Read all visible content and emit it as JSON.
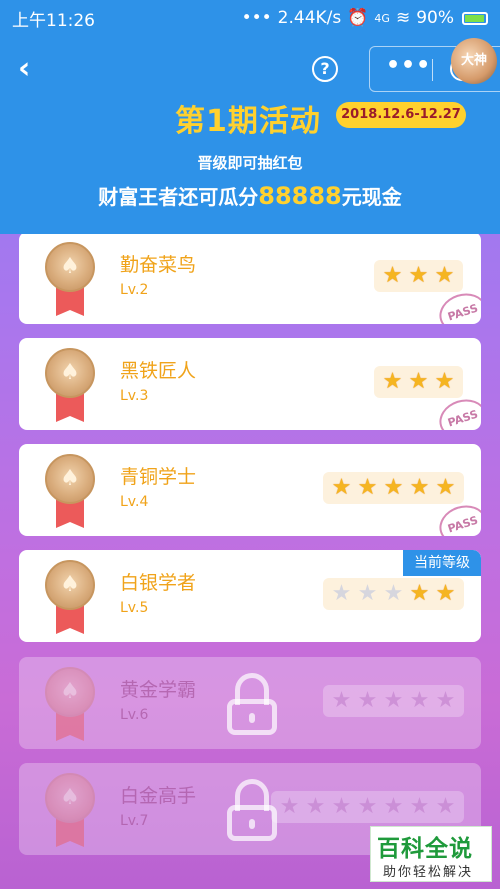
{
  "status_bar": {
    "time": "上午11:26",
    "network_speed": "2.44K/s",
    "signal": "4G",
    "battery": "90%"
  },
  "header": {
    "back_icon": "chevron-left-icon",
    "title": "第1期活动",
    "date_range": "2018.12.6-12.27",
    "subtitle": "晋级即可抽红包",
    "prize_prefix": "财富王者还可瓜分",
    "prize_amount": "88888",
    "prize_suffix": "元现金",
    "avatar_text": "大神"
  },
  "levels": [
    {
      "name": "勤奋菜鸟",
      "level": "Lv.2",
      "stars_total": 3,
      "stars_lit": 3,
      "passed": true,
      "pass_text": "PASS",
      "current": false,
      "locked": false
    },
    {
      "name": "黑铁匠人",
      "level": "Lv.3",
      "stars_total": 3,
      "stars_lit": 3,
      "passed": true,
      "pass_text": "PASS",
      "current": false,
      "locked": false
    },
    {
      "name": "青铜学士",
      "level": "Lv.4",
      "stars_total": 5,
      "stars_lit": 5,
      "passed": true,
      "pass_text": "PASS",
      "current": false,
      "locked": false
    },
    {
      "name": "白银学者",
      "level": "Lv.5",
      "stars_total": 5,
      "stars_lit": 2,
      "passed": false,
      "current": true,
      "current_label": "当前等级",
      "locked": false
    },
    {
      "name": "黄金学霸",
      "level": "Lv.6",
      "stars_total": 5,
      "stars_lit": 0,
      "passed": false,
      "current": false,
      "locked": true
    },
    {
      "name": "白金高手",
      "level": "Lv.7",
      "stars_total": 7,
      "stars_lit": 0,
      "passed": false,
      "current": false,
      "locked": true
    }
  ],
  "watermark": {
    "title": "百科全说",
    "subtitle": "助你轻松解决"
  },
  "colors": {
    "header_blue": "#2e92e8",
    "gold": "#ffd12e",
    "level_text": "#f0a31a",
    "star_on": "#f5b521"
  }
}
